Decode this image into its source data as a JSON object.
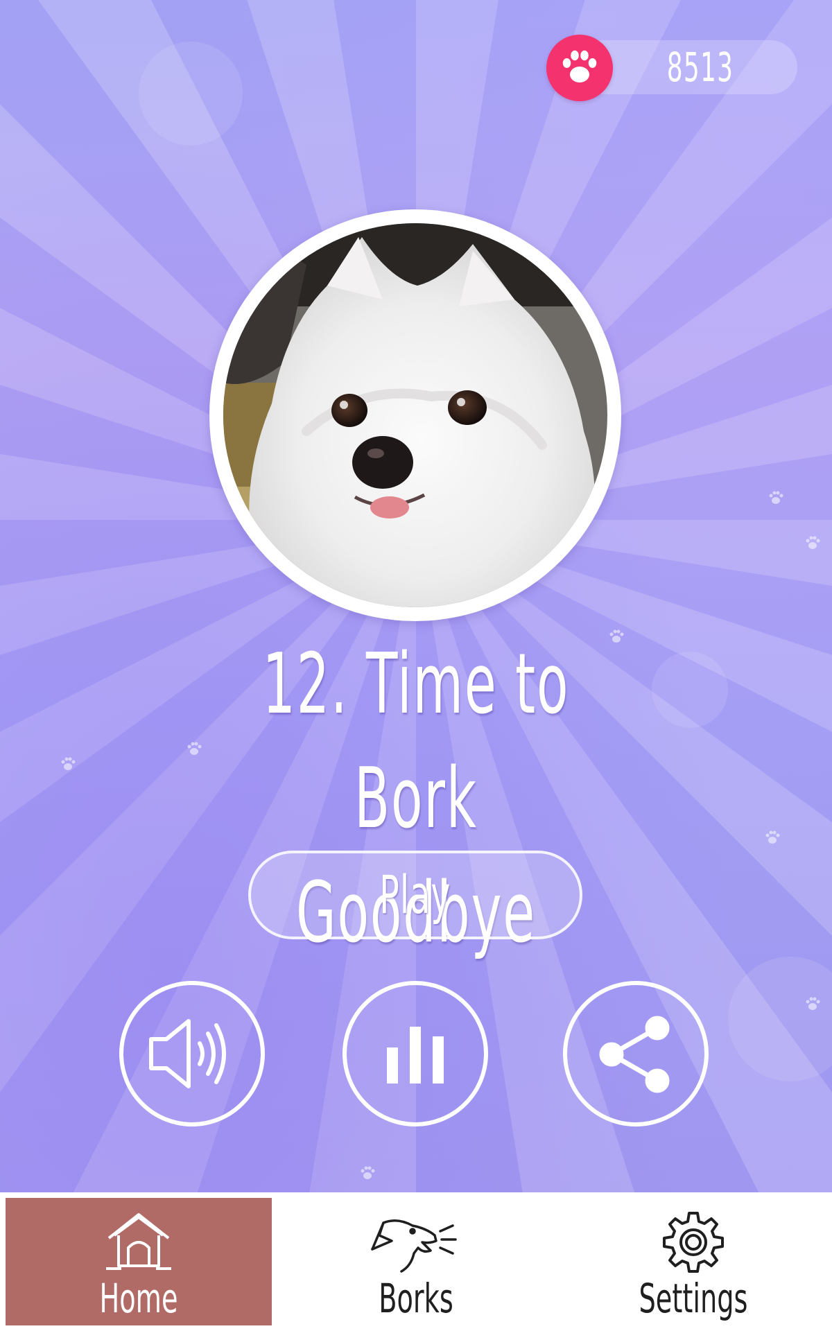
{
  "header": {
    "score": "8513",
    "score_icon": "paw-icon"
  },
  "song": {
    "title_line1": "12. Time to Bork",
    "title_line2": "Goodbye",
    "photo_subject": "white pomeranian dog"
  },
  "controls": {
    "play_label": "Play",
    "sound_icon": "speaker-volume-icon",
    "stats_icon": "bar-chart-icon",
    "share_icon": "share-icon"
  },
  "bottom_nav": {
    "items": [
      {
        "label": "Home",
        "icon": "doghouse-icon",
        "active": true
      },
      {
        "label": "Borks",
        "icon": "barking-dog-icon",
        "active": false
      },
      {
        "label": "Settings",
        "icon": "gear-icon",
        "active": false
      }
    ]
  },
  "colors": {
    "accent_pink": "#f4326e",
    "active_tab": "#b06b67",
    "background": "#a9a3f6"
  }
}
